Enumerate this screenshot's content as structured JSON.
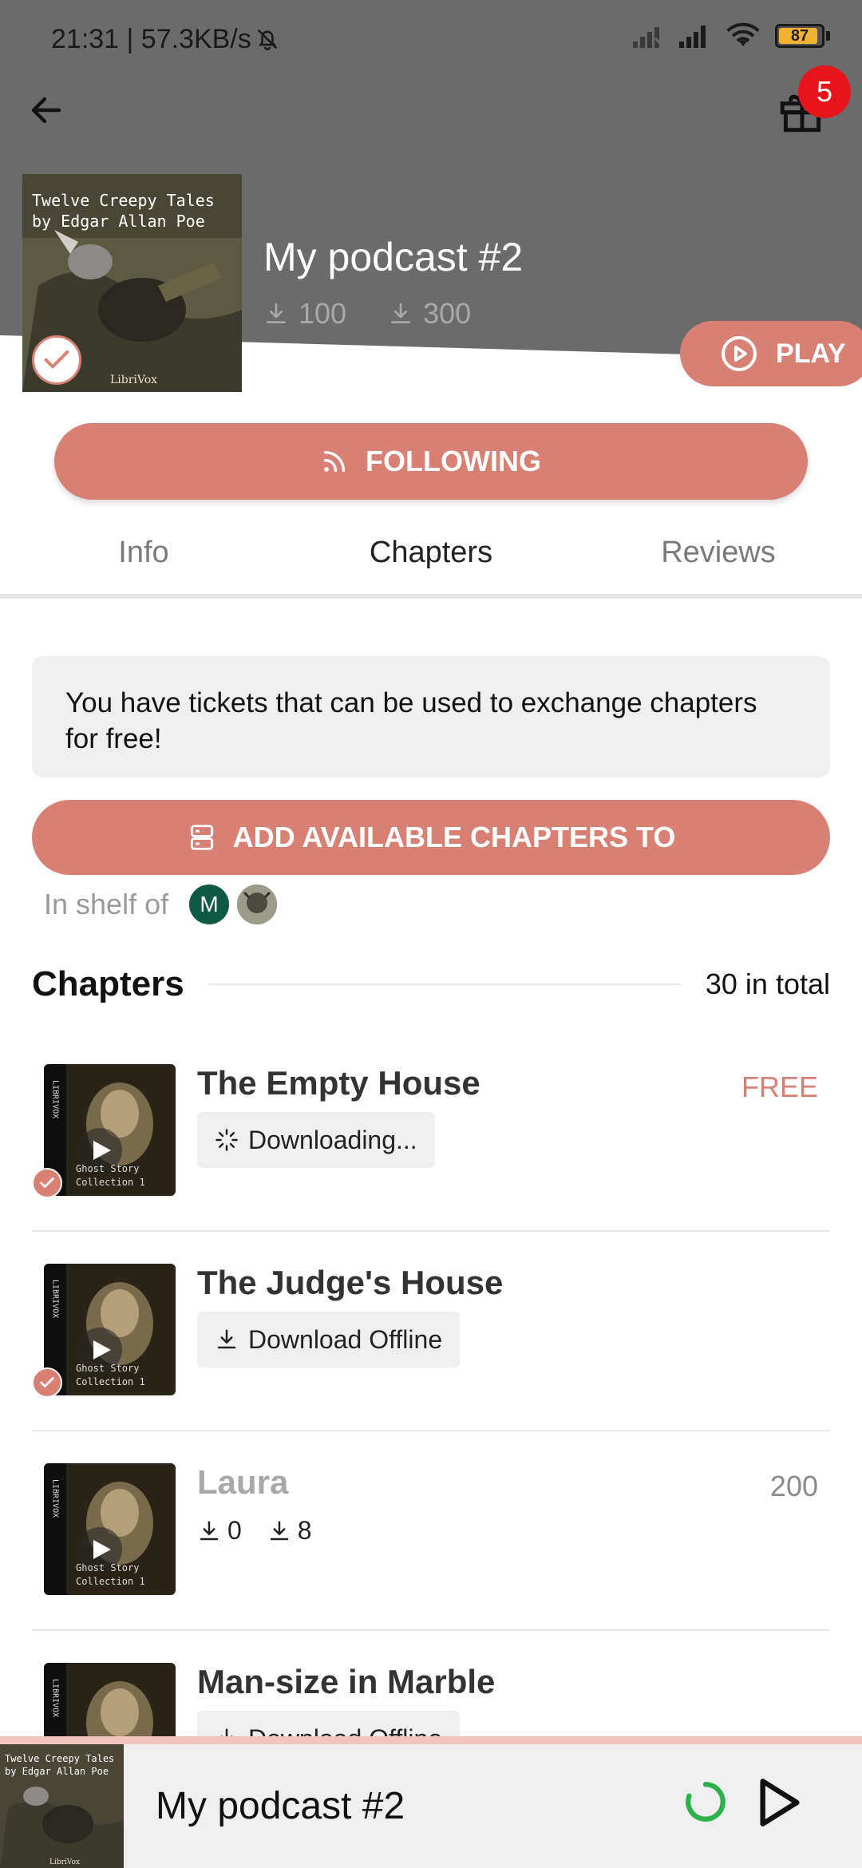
{
  "status_bar": {
    "time_speed": "21:31 | 57.3KB/s",
    "battery": "87"
  },
  "header": {
    "gift_badge": "5",
    "podcast_title": "My podcast #2",
    "stat_a": "100",
    "stat_b": "300",
    "cover_text_line1": "Twelve Creepy Tales",
    "cover_text_line2": "by Edgar Allan Poe",
    "cover_publisher": "LibriVox",
    "play_label": "PLAY",
    "follow_label": "FOLLOWING"
  },
  "tabs": [
    {
      "label": "Info"
    },
    {
      "label": "Chapters"
    },
    {
      "label": "Reviews"
    }
  ],
  "ticket_notice": "You have tickets that can be used to exchange chapters for free!",
  "add_button_label": "ADD AVAILABLE CHAPTERS TO",
  "shelf": {
    "label": "In shelf of",
    "avatar_initial": "M"
  },
  "chapters_section": {
    "title": "Chapters",
    "count": "30 in total"
  },
  "chapters": [
    {
      "title": "The Empty House",
      "action": "Downloading...",
      "price": "FREE"
    },
    {
      "title": "The Judge's House",
      "action": "Download Offline",
      "price": ""
    },
    {
      "title": "Laura",
      "stat_a": "0",
      "stat_b": "8",
      "price": "200"
    },
    {
      "title": "Man-size in Marble",
      "action": "Download Offline",
      "price": ""
    }
  ],
  "thumb_text": {
    "side": "LIBRIVOX",
    "line1": "Ghost Story",
    "line2": "Collection 1"
  },
  "mini_player": {
    "title": "My podcast #2"
  },
  "colors": {
    "accent": "#d98074",
    "header_gray": "#6b6b6b",
    "badge_red": "#e8141c",
    "spinner_green": "#2db24a"
  }
}
